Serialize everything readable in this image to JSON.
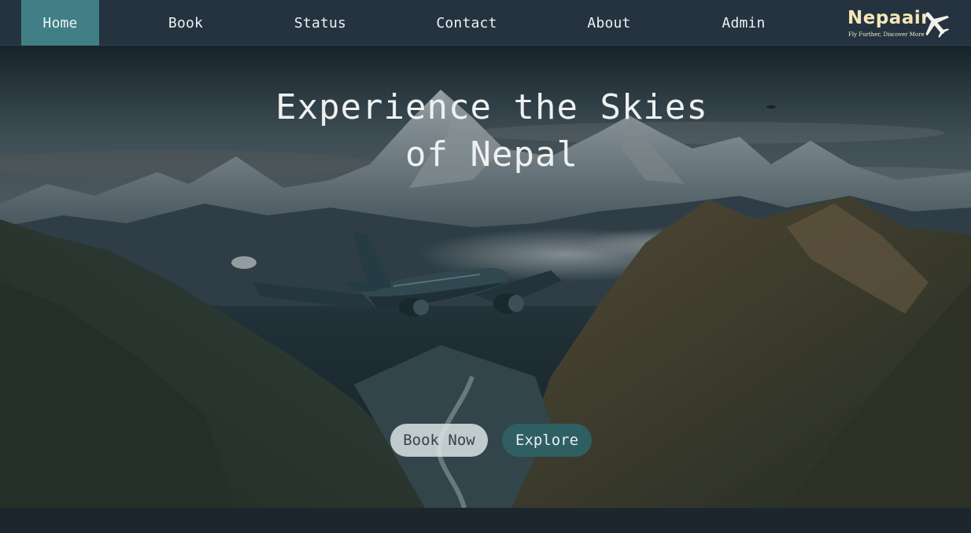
{
  "nav": {
    "items": [
      {
        "label": "Home",
        "active": true
      },
      {
        "label": "Book"
      },
      {
        "label": "Status"
      },
      {
        "label": "Contact"
      },
      {
        "label": "About"
      },
      {
        "label": "Admin"
      }
    ]
  },
  "logo": {
    "name": "Nepaair",
    "tagline": "Fly Further, Discover More",
    "icon": "airplane-icon"
  },
  "hero": {
    "title_line1": "Experience the Skies",
    "title_line2": "of Nepal",
    "book_button": "Book Now",
    "explore_button": "Explore"
  },
  "colors": {
    "nav_bg": "#24333f",
    "nav_active": "#3f7f85",
    "logo_text": "#f6e6b8",
    "explore_bg": "#2f5f63",
    "page_bg": "#1b262e"
  }
}
